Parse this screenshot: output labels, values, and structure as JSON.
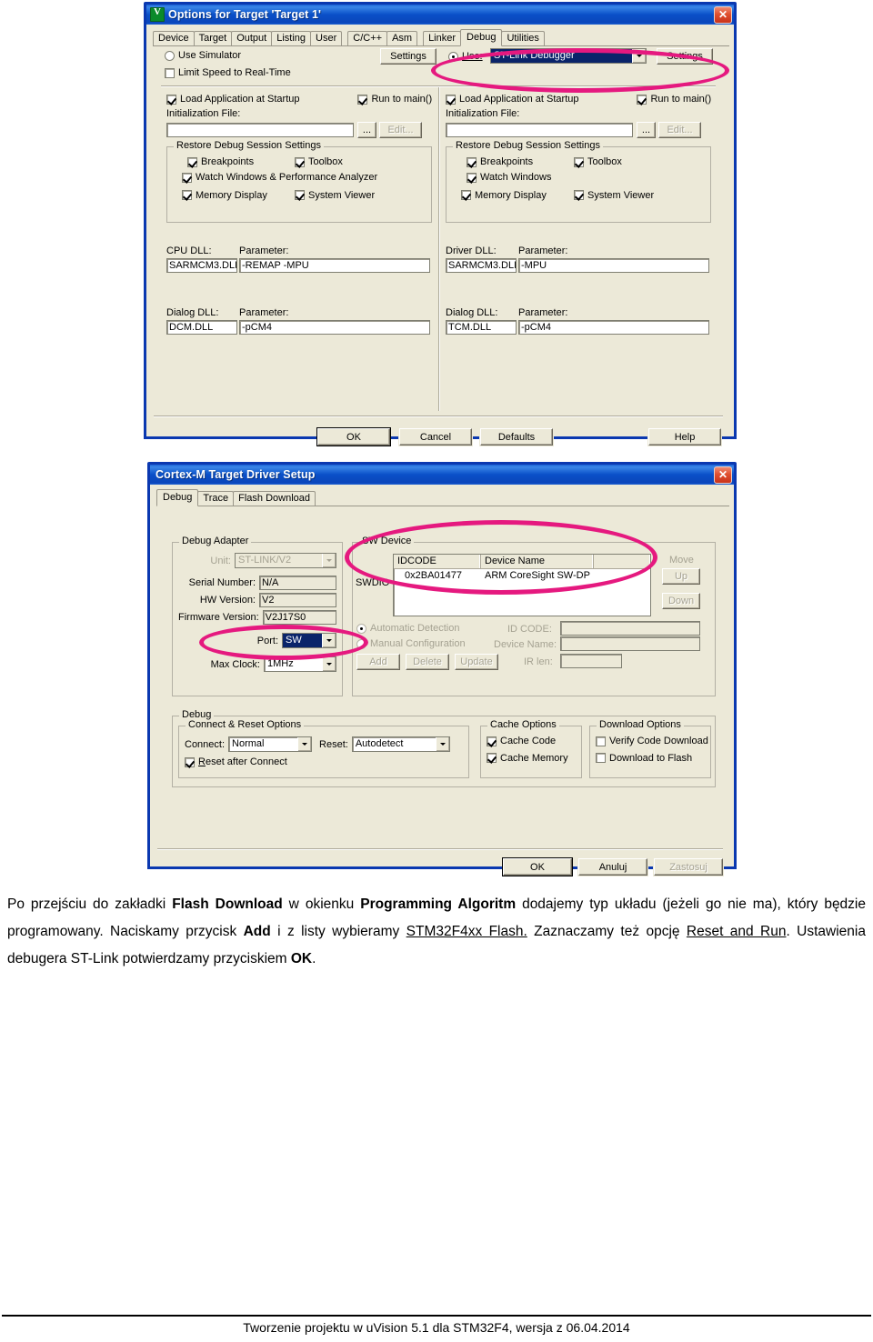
{
  "dialog1": {
    "title": "Options for Target 'Target 1'",
    "icon": "uvision-icon",
    "close_label": "✕",
    "tabs": [
      {
        "label": "Device"
      },
      {
        "label": "Target"
      },
      {
        "label": "Output"
      },
      {
        "label": "Listing"
      },
      {
        "label": "User"
      },
      {
        "label": "C/C++"
      },
      {
        "label": "Asm"
      },
      {
        "label": "Linker"
      },
      {
        "label": "Debug"
      },
      {
        "label": "Utilities"
      }
    ],
    "selected_tab": "Debug",
    "left": {
      "use_simulator": {
        "label": "Use Simulator",
        "checked": false
      },
      "limit_speed": {
        "label": "Limit Speed to Real-Time",
        "checked": false
      },
      "settings_button": "Settings",
      "load_app": {
        "label": "Load Application at Startup",
        "checked": true
      },
      "run_to_main": {
        "label": "Run to main()",
        "checked": true
      },
      "init_file_label": "Initialization File:",
      "init_file_value": "",
      "browse_button": "...",
      "edit_button": "Edit...",
      "restore_group": "Restore Debug Session Settings",
      "restore_items": [
        {
          "label": "Breakpoints",
          "checked": true
        },
        {
          "label": "Toolbox",
          "checked": true
        },
        {
          "label": "Watch Windows & Performance Analyzer",
          "checked": true
        },
        {
          "label": "Memory Display",
          "checked": true
        },
        {
          "label": "System Viewer",
          "checked": true
        }
      ],
      "cpu_dll_label": "CPU DLL:",
      "cpu_dll_value": "SARMCM3.DLL",
      "cpu_param_label": "Parameter:",
      "cpu_param_value": "-REMAP -MPU",
      "dialog_dll_label": "Dialog DLL:",
      "dialog_dll_value": "DCM.DLL",
      "dialog_param_label": "Parameter:",
      "dialog_param_value": "-pCM4"
    },
    "right": {
      "use_label": "Use:",
      "use_value": "ST-Link Debugger",
      "settings_button": "Settings",
      "load_app": {
        "label": "Load Application at Startup",
        "checked": true
      },
      "run_to_main": {
        "label": "Run to main()",
        "checked": true
      },
      "init_file_label": "Initialization File:",
      "init_file_value": "",
      "browse_button": "...",
      "edit_button": "Edit...",
      "restore_group": "Restore Debug Session Settings",
      "restore_items": [
        {
          "label": "Breakpoints",
          "checked": true
        },
        {
          "label": "Toolbox",
          "checked": true
        },
        {
          "label": "Watch Windows",
          "checked": true
        },
        {
          "label": "Memory Display",
          "checked": true
        },
        {
          "label": "System Viewer",
          "checked": true
        }
      ],
      "driver_dll_label": "Driver DLL:",
      "driver_dll_value": "SARMCM3.DLL",
      "driver_param_label": "Parameter:",
      "driver_param_value": "-MPU",
      "dialog_dll_label": "Dialog DLL:",
      "dialog_dll_value": "TCM.DLL",
      "dialog_param_label": "Parameter:",
      "dialog_param_value": "-pCM4"
    },
    "buttons": {
      "ok": "OK",
      "cancel": "Cancel",
      "defaults": "Defaults",
      "help": "Help"
    }
  },
  "dialog2": {
    "title": "Cortex-M Target Driver Setup",
    "close_label": "✕",
    "tabs": [
      {
        "label": "Debug"
      },
      {
        "label": "Trace"
      },
      {
        "label": "Flash Download"
      }
    ],
    "selected_tab": "Debug",
    "adapter": {
      "group": "Debug Adapter",
      "unit_label": "Unit:",
      "unit_value": "ST-LINK/V2",
      "serial_label": "Serial Number:",
      "serial_value": "N/A",
      "hw_label": "HW Version:",
      "hw_value": "V2",
      "fw_label": "Firmware Version:",
      "fw_value": "V2J17S0",
      "port_label": "Port:",
      "port_value": "SW",
      "clock_label": "Max Clock:",
      "clock_value": "1MHz"
    },
    "swdevice": {
      "group": "SW Device",
      "side_label": "SWDIO",
      "columns": [
        "IDCODE",
        "Device Name",
        ""
      ],
      "rows": [
        [
          "0x2BA01477",
          "ARM CoreSight SW-DP",
          ""
        ]
      ],
      "move_label": "Move",
      "up_button": "Up",
      "down_button": "Down",
      "automatic_detection": {
        "label": "Automatic Detection",
        "checked": true
      },
      "manual_configuration": {
        "label": "Manual Configuration",
        "checked": false
      },
      "idcode_label": "ID CODE:",
      "idcode_value": "",
      "devname_label": "Device Name:",
      "devname_value": "",
      "irlen_label": "IR len:",
      "irlen_value": "",
      "add_button": "Add",
      "delete_button": "Delete",
      "update_button": "Update"
    },
    "debug": {
      "group": "Debug",
      "connect_group": "Connect & Reset Options",
      "connect_label": "Connect:",
      "connect_value": "Normal",
      "reset_label": "Reset:",
      "reset_value": "Autodetect",
      "reset_after_connect": {
        "label": "Reset after Connect",
        "checked": true
      },
      "cache_group": "Cache Options",
      "cache_code": {
        "label": "Cache Code",
        "checked": true
      },
      "cache_memory": {
        "label": "Cache Memory",
        "checked": true
      },
      "download_group": "Download Options",
      "verify_code": {
        "label": "Verify Code Download",
        "checked": false
      },
      "download_flash": {
        "label": "Download to Flash",
        "checked": false
      }
    },
    "buttons": {
      "ok": "OK",
      "cancel": "Anuluj",
      "apply": "Zastosuj"
    }
  },
  "body_text": {
    "line1_a": "Po przejściu do zakładki ",
    "line1_b": "Flash Download",
    "line1_c": " w okienku ",
    "line1_d": "Programming Algoritm",
    "line1_e": " dodajemy typ układu (jeżeli go nie ma), który będzie programowany. Naciskamy przycisk ",
    "line1_f": "Add",
    "line1_g": " i z listy wybieramy ",
    "line1_h": "STM32F4xx Flash.",
    "line1_i": " Zaznaczamy też opcję ",
    "line1_j": "Reset and Run",
    "line1_k": ". Ustawienia debugera ST-Link potwierdzamy przyciskiem ",
    "line1_l": "OK",
    "line1_m": "."
  },
  "footer": {
    "text": "Tworzenie projektu w uVision 5.1 dla STM32F4,  wersja z 06.04.2014"
  },
  "colors": {
    "marker": "#e5197f",
    "titlebar": "#0a50c8",
    "dialog_face": "#ece9d8",
    "selection": "#0a246a"
  }
}
